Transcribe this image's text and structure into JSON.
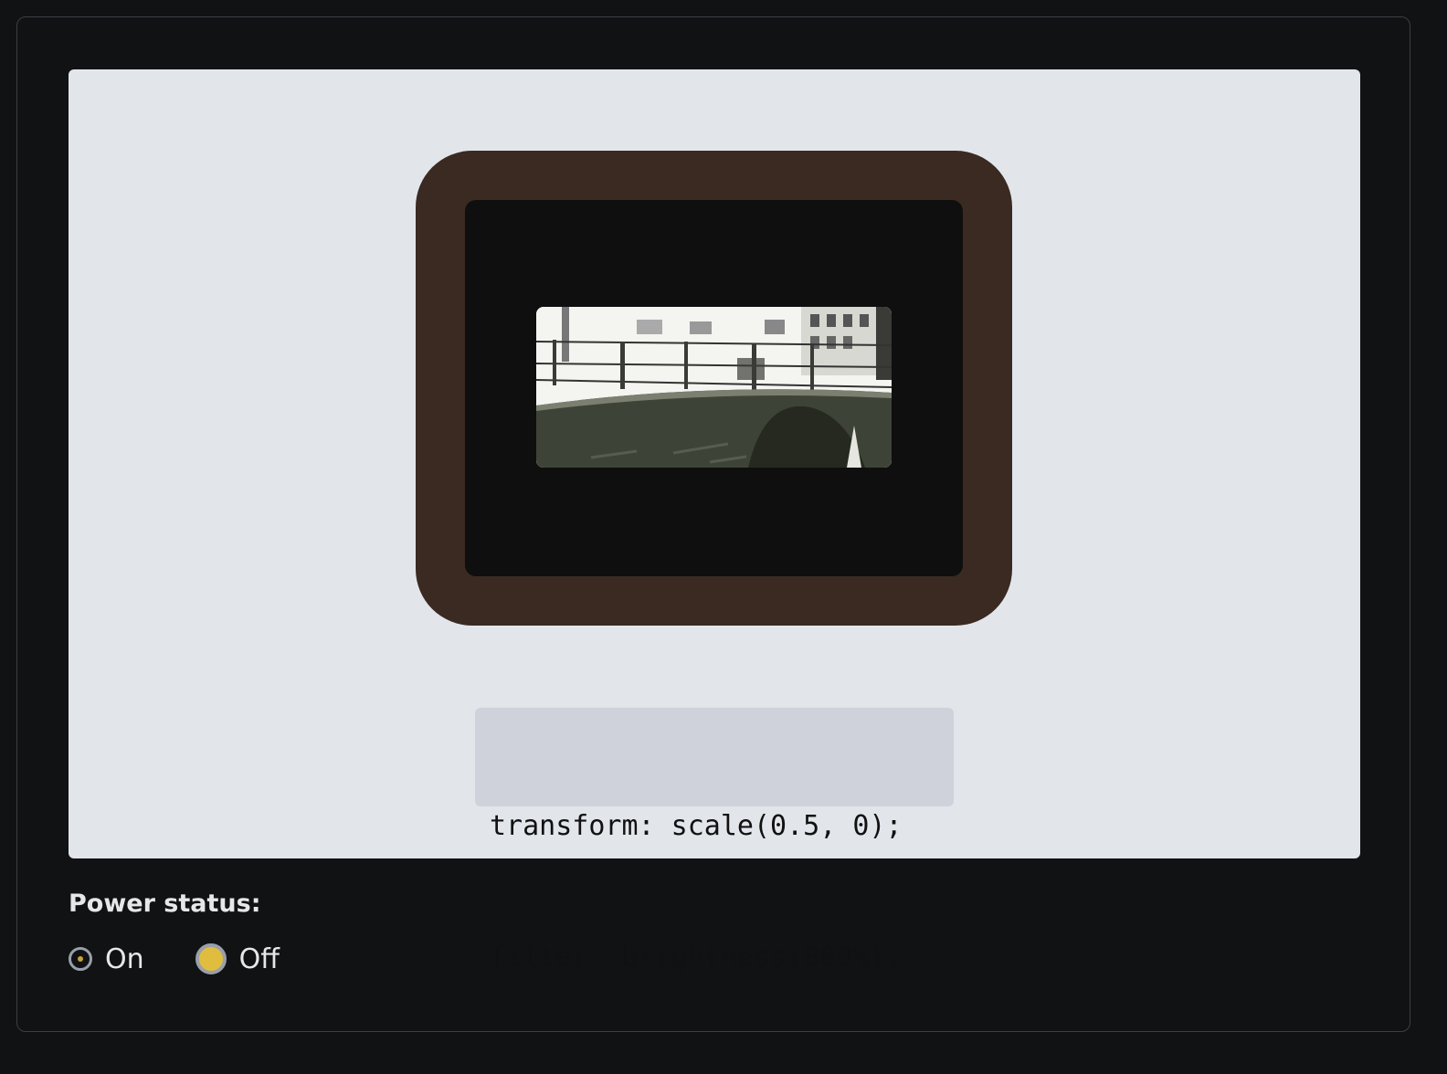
{
  "demo": {
    "code_lines": [
      "transform: scale(0.5, 0);",
      "filter: brightness(800%);"
    ]
  },
  "power": {
    "label": "Power status:",
    "options": [
      {
        "label": "On",
        "checked": false
      },
      {
        "label": "Off",
        "checked": true
      }
    ]
  },
  "colors": {
    "page_bg": "#111214",
    "stage_bg": "#e2e6eb",
    "tv_frame": "#3a2a22",
    "tv_screen": "#0f0f0f",
    "code_bg": "#cfd2da",
    "radio_checked_fill": "#e1bd3f"
  }
}
